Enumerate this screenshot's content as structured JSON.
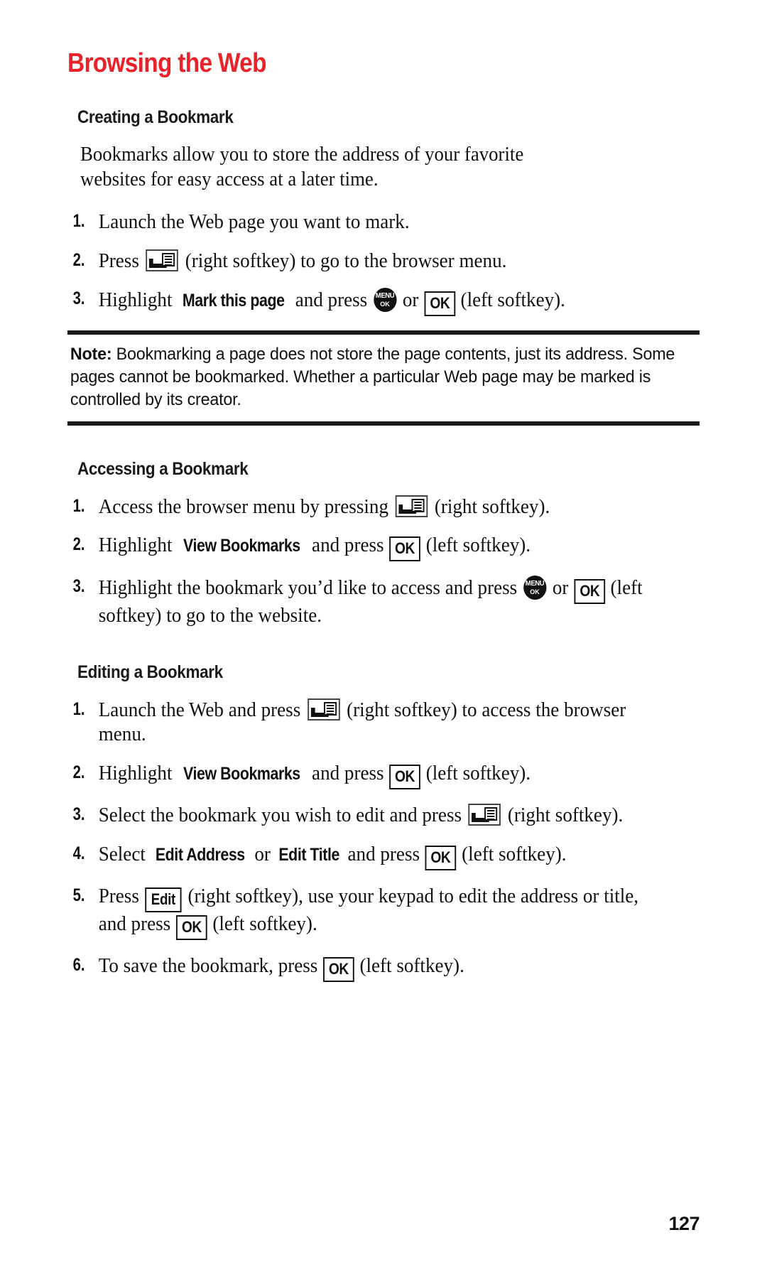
{
  "chapter": {
    "title": "Browsing the Web",
    "accent_color": "#e8232a"
  },
  "sections": [
    {
      "heading": "Creating a Bookmark",
      "paragraph": "Bookmarks allow you to store the address of your favorite websites for easy access at a later time."
    },
    {
      "heading": "Accessing a Bookmark"
    },
    {
      "heading": "Editing a Bookmark"
    }
  ],
  "creating_steps": {
    "s1_num": "1.",
    "s1_text": "Launch the Web page you want to mark.",
    "s2_num": "2.",
    "s2_pre": "Press",
    "s2_post": "(right softkey) to go to the browser menu.",
    "s3_num": "3.",
    "s3_pre": "Highlight",
    "s3_bold": "Mark this page",
    "s3_mid": "and press",
    "s3_or": "or",
    "s3_post": "(left softkey)."
  },
  "note": {
    "label": "Note:",
    "text": "Bookmarking a page does not store the page contents, just its address. Some pages cannot be bookmarked. Whether a particular Web page may be marked is controlled by its creator."
  },
  "accessing_steps": {
    "s1_num": "1.",
    "s1_pre": "Access the browser menu by pressing",
    "s1_post": "(right softkey).",
    "s2_num": "2.",
    "s2_pre": "Highlight",
    "s2_bold": "View Bookmarks",
    "s2_mid": "and press",
    "s2_post": "(left softkey).",
    "s3_num": "3.",
    "s3_pre": "Highlight the bookmark you’d like to access and press",
    "s3_or": "or",
    "s3_post": "(left softkey) to go to the website."
  },
  "editing_steps": {
    "s1_num": "1.",
    "s1_pre": "Launch the Web and press",
    "s1_post": "(right softkey) to access the browser menu.",
    "s2_num": "2.",
    "s2_pre": "Highlight",
    "s2_bold": "View Bookmarks",
    "s2_mid": "and press",
    "s2_post": "(left softkey).",
    "s3_num": "3.",
    "s3_pre": "Select the bookmark you wish to edit and press",
    "s3_post": "(right softkey).",
    "s4_num": "4.",
    "s4_pre": "Select",
    "s4_bold1": "Edit Address",
    "s4_or": "or",
    "s4_bold2": "Edit Title",
    "s4_mid": "and press",
    "s4_post": "(left softkey).",
    "s5_num": "5.",
    "s5_pre": "Press",
    "s5_post": "(right softkey), use your keypad to edit the address or title, and press",
    "s5_tail": "(left softkey).",
    "s6_num": "6.",
    "s6_pre": "To save the bookmark, press",
    "s6_post": "(left softkey)."
  },
  "keys": {
    "ok_label": "OK",
    "edit_label": "Edit",
    "menu_top": "MENU",
    "menu_bottom": "OK"
  },
  "footer": {
    "page_number": "127"
  }
}
